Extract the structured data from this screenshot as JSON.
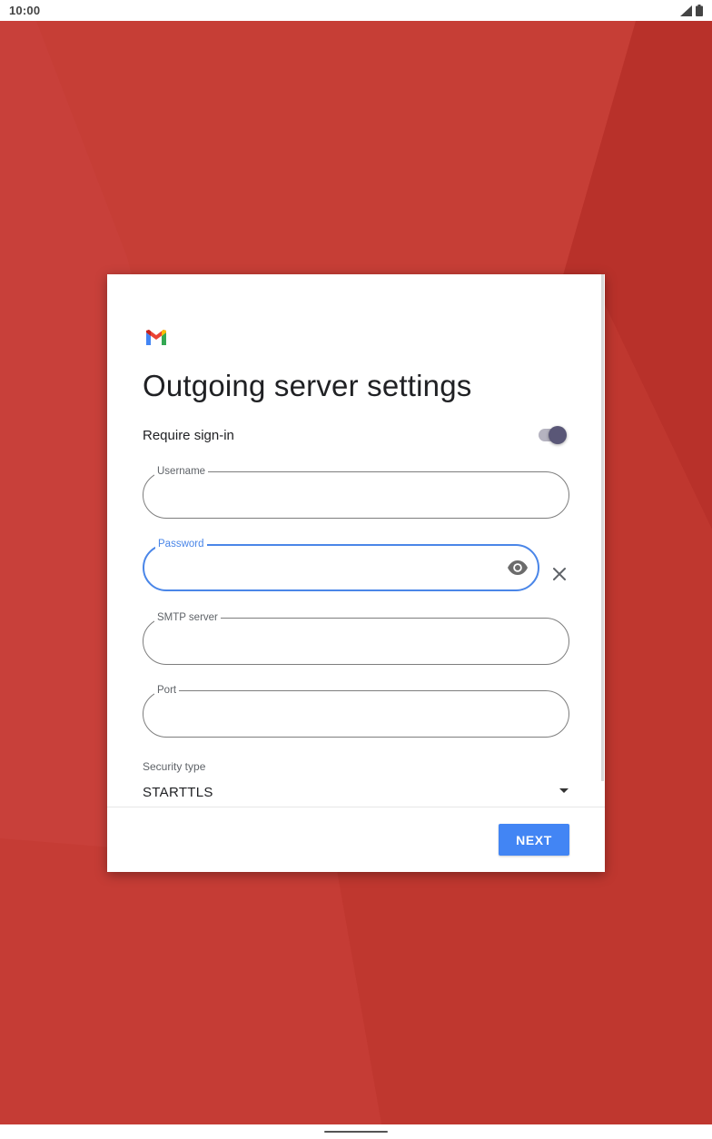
{
  "status_bar": {
    "time": "10:00",
    "icons": [
      "signal-icon",
      "battery-icon"
    ]
  },
  "dialog": {
    "logo": "gmail-logo",
    "title": "Outgoing server settings",
    "require_signin": {
      "label": "Require sign-in",
      "enabled": true
    },
    "fields": {
      "username": {
        "label": "Username",
        "value": ""
      },
      "password": {
        "label": "Password",
        "value": "",
        "focused": true
      },
      "smtp_server": {
        "label": "SMTP server",
        "value": ""
      },
      "port": {
        "label": "Port",
        "value": ""
      }
    },
    "security": {
      "label": "Security type",
      "value": "STARTTLS"
    },
    "next_label": "NEXT"
  },
  "colors": {
    "background": "#c8403a",
    "accent": "#4285f4",
    "focus": "#4a86e8",
    "toggle_thumb": "#5a5777"
  }
}
